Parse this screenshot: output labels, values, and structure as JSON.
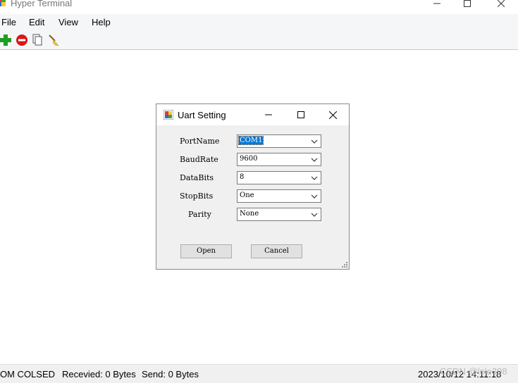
{
  "window": {
    "title": "Hyper Terminal",
    "minimize_glyph": "—",
    "maximize_glyph": "☐",
    "close_glyph": "✕"
  },
  "menu": [
    {
      "label": "File"
    },
    {
      "label": "Edit"
    },
    {
      "label": "View"
    },
    {
      "label": "Help"
    }
  ],
  "toolbar": {
    "icons": [
      "add-icon",
      "stop-icon",
      "copy-icon",
      "clear-broom-icon"
    ],
    "colors": {
      "add": "#1e9e1e",
      "stop": "#d81818"
    }
  },
  "status": {
    "connection": "OM COLSED",
    "received": "Recevied: 0 Bytes",
    "send": "Send: 0 Bytes",
    "datetime": "2023/10/12 14:11:18",
    "watermark": "CSDN @lele398"
  },
  "dialog": {
    "title": "Uart Setting",
    "fields": [
      {
        "label": "PortName",
        "value": "COM1"
      },
      {
        "label": "BaudRate",
        "value": "9600"
      },
      {
        "label": "DataBits",
        "value": "8"
      },
      {
        "label": "StopBits",
        "value": "One"
      },
      {
        "label": "Parity",
        "value": "None"
      }
    ],
    "open_label": "Open",
    "cancel_label": "Cancel",
    "selection_color": "#0078d7"
  }
}
